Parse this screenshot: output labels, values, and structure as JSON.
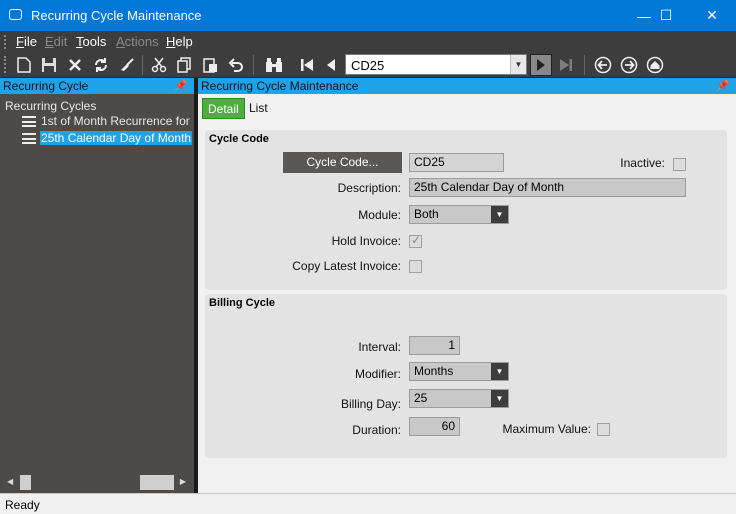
{
  "window": {
    "title": "Recurring Cycle Maintenance",
    "controls": {
      "minimize": "—",
      "maximize": "☐",
      "close": "✕"
    }
  },
  "menu": {
    "items": [
      {
        "label": "File",
        "accel": "F",
        "rest": "ile",
        "enabled": true
      },
      {
        "label": "Edit",
        "accel": "E",
        "rest": "dit",
        "enabled": false
      },
      {
        "label": "Tools",
        "accel": "T",
        "rest": "ools",
        "enabled": true
      },
      {
        "label": "Actions",
        "accel": "A",
        "rest": "ctions",
        "enabled": false
      },
      {
        "label": "Help",
        "accel": "H",
        "rest": "elp",
        "enabled": true
      }
    ]
  },
  "toolbar": {
    "buttons": [
      "new-icon",
      "save-icon",
      "delete-icon",
      "refresh-icon",
      "clear-icon",
      "cut-icon",
      "copy-icon",
      "paste-icon",
      "undo-icon",
      "search-icon",
      "first-record-icon",
      "previous-record-icon",
      "next-record-icon",
      "last-record-icon",
      "back-icon",
      "forward-icon",
      "home-icon"
    ],
    "record_combo": "CD25"
  },
  "left_pane": {
    "header": "Recurring Cycle",
    "tree": {
      "root": "Recurring Cycles",
      "items": [
        {
          "label": "1st of Month Recurrence for",
          "selected": false
        },
        {
          "label": "25th Calendar Day of Month",
          "selected": true
        }
      ]
    }
  },
  "right_pane": {
    "header": "Recurring Cycle Maintenance",
    "tabs": [
      {
        "label": "Detail",
        "active": true
      },
      {
        "label": "List",
        "active": false
      }
    ],
    "cycle_code_group": {
      "title": "Cycle Code",
      "cycle_code_button": "Cycle Code...",
      "cycle_code_value": "CD25",
      "inactive_label": "Inactive:",
      "inactive_checked": false,
      "description_label": "Description:",
      "description_value": "25th Calendar Day of Month",
      "module_label": "Module:",
      "module_value": "Both",
      "hold_invoice_label": "Hold Invoice:",
      "hold_invoice_checked": true,
      "copy_latest_label": "Copy Latest Invoice:",
      "copy_latest_checked": false
    },
    "billing_group": {
      "title": "Billing Cycle",
      "interval_label": "Interval:",
      "interval_value": "1",
      "modifier_label": "Modifier:",
      "modifier_value": "Months",
      "billing_day_label": "Billing Day:",
      "billing_day_value": "25",
      "duration_label": "Duration:",
      "duration_value": "60",
      "max_value_label": "Maximum Value:",
      "max_value_checked": false
    }
  },
  "status": {
    "text": "Ready"
  },
  "colors": {
    "titlebar": "#0078d7",
    "pane_header": "#1fa3e8",
    "active_tab": "#4caf3e",
    "toolbar_bg": "#3d3d3d"
  }
}
